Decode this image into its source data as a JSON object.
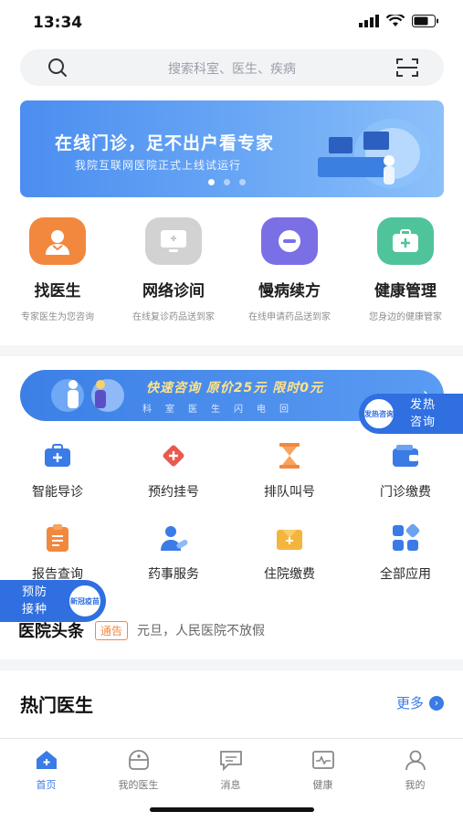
{
  "status_bar": {
    "time": "13:34"
  },
  "search": {
    "placeholder": "搜索科室、医生、疾病"
  },
  "banner": {
    "title": "在线门诊，足不出户看专家",
    "subtitle": "我院互联网医院正式上线试运行",
    "dots": 3,
    "active_dot": 0
  },
  "quick_services": [
    {
      "label": "找医生",
      "sub": "专家医生为您咨询",
      "icon": "doctor-icon",
      "color": "#f2883e"
    },
    {
      "label": "网络诊间",
      "sub": "在线复诊药品送到家",
      "icon": "monitor-icon",
      "color": "#c9c9c9"
    },
    {
      "label": "慢病续方",
      "sub": "在线申请药品送到家",
      "icon": "pill-icon",
      "color": "#7b6fe6"
    },
    {
      "label": "健康管理",
      "sub": "您身边的健康管家",
      "icon": "medkit-icon",
      "color": "#4fc49a"
    }
  ],
  "promo": {
    "headline": "快速咨询  原价25元  限时0元",
    "sub": "科室医生闪电回"
  },
  "float_right": {
    "badge": "发热咨询",
    "line1": "发热",
    "line2": "咨询"
  },
  "services": [
    {
      "label": "智能导诊",
      "icon": "medical-bag-icon"
    },
    {
      "label": "预约挂号",
      "icon": "diamond-cross-icon"
    },
    {
      "label": "排队叫号",
      "icon": "hourglass-icon"
    },
    {
      "label": "门诊缴费",
      "icon": "wallet-icon"
    },
    {
      "label": "报告查询",
      "icon": "clipboard-icon"
    },
    {
      "label": "药事服务",
      "icon": "pharmacy-icon"
    },
    {
      "label": "住院缴费",
      "icon": "hospital-fee-icon"
    },
    {
      "label": "全部应用",
      "icon": "apps-icon"
    }
  ],
  "float_left": {
    "badge": "新冠疫苗",
    "line1": "预防",
    "line2": "接种"
  },
  "news": {
    "logo": "医院头条",
    "tag": "通告",
    "text": "元旦，人民医院不放假"
  },
  "hot_doctors": {
    "title": "热门医生",
    "more": "更多"
  },
  "tabbar": [
    {
      "label": "首页",
      "icon": "home-icon",
      "active": true
    },
    {
      "label": "我的医生",
      "icon": "doctor-face-icon",
      "active": false
    },
    {
      "label": "消息",
      "icon": "message-icon",
      "active": false
    },
    {
      "label": "健康",
      "icon": "heartbeat-icon",
      "active": false
    },
    {
      "label": "我的",
      "icon": "user-icon",
      "active": false
    }
  ],
  "colors": {
    "accent": "#3a7be6",
    "banner_blue": "#4b8ef0",
    "orange": "#f2883e"
  }
}
